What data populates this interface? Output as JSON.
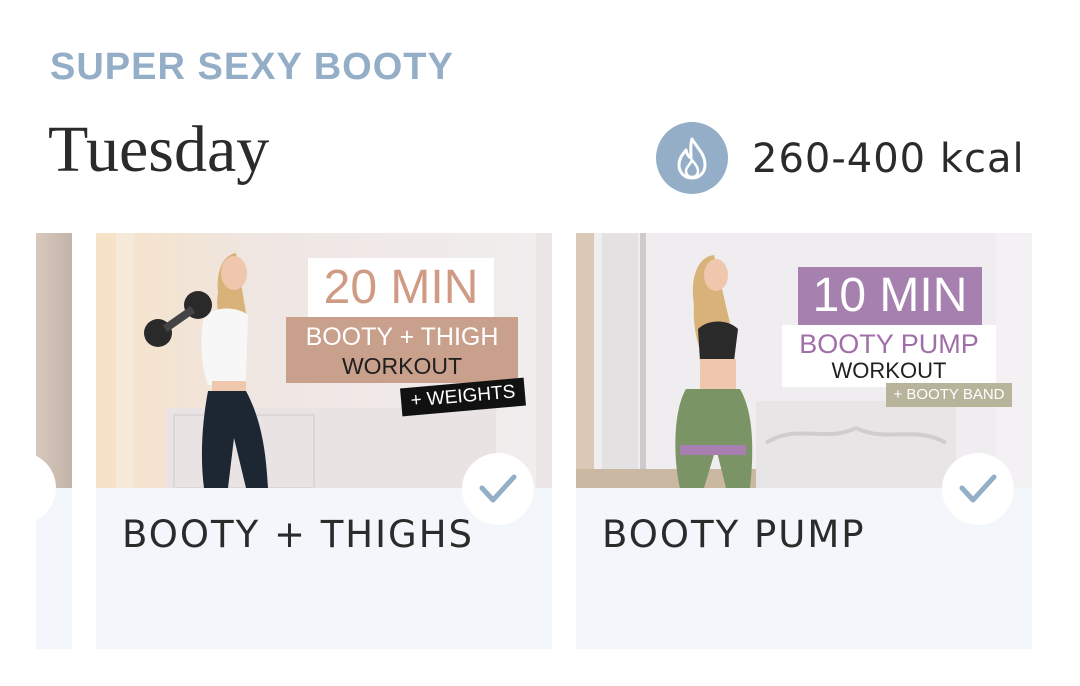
{
  "header": {
    "program_title": "SUPER SEXY BOOTY",
    "day": "Tuesday",
    "kcal_icon": "flame-icon",
    "kcal": "260-400 kcal",
    "accent_color": "#93aec6"
  },
  "workouts": [
    {
      "title": "BOOTY + THIGHS",
      "completed": true,
      "thumbnail": {
        "duration": "20 MIN",
        "line1": "BOOTY + THIGH",
        "line2": "WORKOUT",
        "tag": "+ WEIGHTS",
        "accent_color": "#c9a08c"
      }
    },
    {
      "title": "BOOTY PUMP",
      "completed": true,
      "thumbnail": {
        "duration": "10 MIN",
        "line1": "BOOTY PUMP",
        "line2": "WORKOUT",
        "tag": "+ BOOTY BAND",
        "accent_color": "#a680ae"
      }
    }
  ]
}
